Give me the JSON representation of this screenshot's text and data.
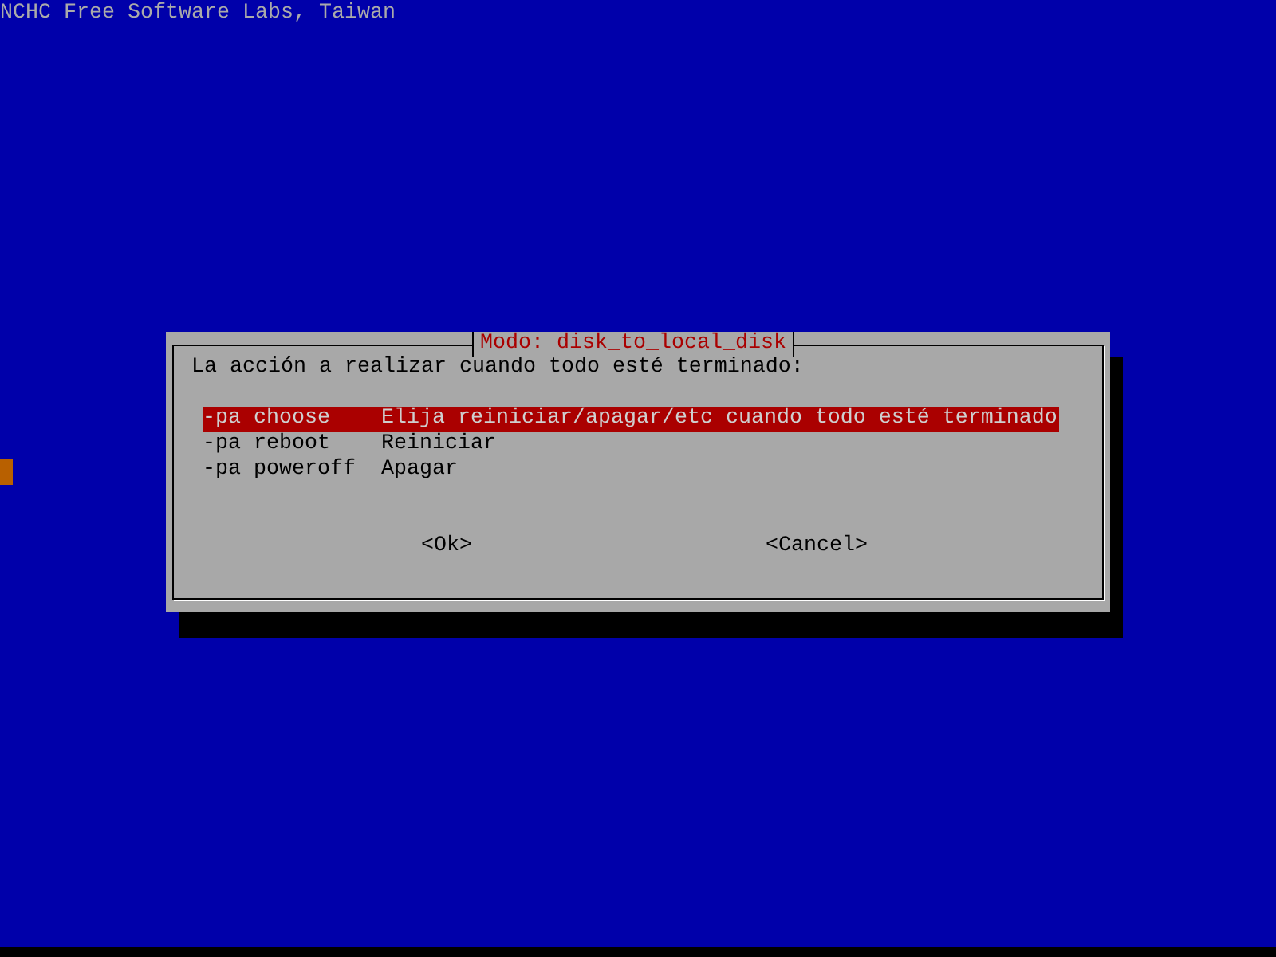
{
  "header": {
    "title": "NCHC Free Software Labs, Taiwan"
  },
  "dialog": {
    "title": "Modo: disk_to_local_disk",
    "prompt": "La acción a realizar cuando todo esté terminado:",
    "items": [
      {
        "tag": "-pa choose",
        "description": "Elija reiniciar/apagar/etc cuando todo esté terminado",
        "selected": true
      },
      {
        "tag": "-pa reboot",
        "description": "Reiniciar",
        "selected": false
      },
      {
        "tag": "-pa poweroff",
        "description": "Apagar",
        "selected": false
      }
    ],
    "buttons": [
      "<Ok>",
      "<Cancel>"
    ]
  }
}
